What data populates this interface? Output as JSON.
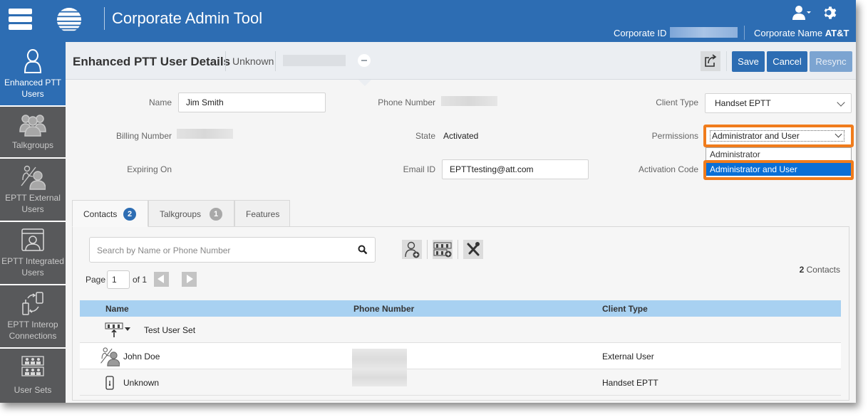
{
  "header": {
    "app_title": "Corporate Admin Tool",
    "corporate_id_label": "Corporate ID",
    "corporate_name_label": "Corporate Name",
    "corporate_name_value": "AT&T",
    "icons": [
      "menu-icon",
      "att-globe-logo",
      "user-menu-icon",
      "settings-gear-icon"
    ]
  },
  "sidebar": {
    "items": [
      {
        "label": "Enhanced PTT Users",
        "icon": "user-icon",
        "active": true
      },
      {
        "label": "Talkgroups",
        "icon": "group-icon",
        "active": false
      },
      {
        "label": "EPTT External Users",
        "icon": "external-user-icon",
        "active": false
      },
      {
        "label": "EPTT Integrated Users",
        "icon": "integrated-user-icon",
        "active": false
      },
      {
        "label": "EPTT Interop Connections",
        "icon": "interop-icon",
        "active": false
      },
      {
        "label": "User Sets",
        "icon": "user-sets-icon",
        "active": false
      }
    ]
  },
  "titlebar": {
    "title": "Enhanced PTT User Details",
    "subtitle": "Unknown",
    "buttons": {
      "save": "Save",
      "cancel": "Cancel",
      "resync": "Resync"
    }
  },
  "form": {
    "name": {
      "label": "Name",
      "value": "Jim Smith"
    },
    "phone_number": {
      "label": "Phone Number"
    },
    "client_type": {
      "label": "Client Type",
      "value": "Handset EPTT"
    },
    "billing_number": {
      "label": "Billing Number"
    },
    "state": {
      "label": "State",
      "value": "Activated"
    },
    "permissions": {
      "label": "Permissions",
      "value": "Administrator and User",
      "options": [
        "Administrator",
        "Administrator and User"
      ],
      "highlighted_option": "Administrator and User"
    },
    "expiring_on": {
      "label": "Expiring On"
    },
    "email": {
      "label": "Email ID",
      "value": "EPTTtesting@att.com"
    },
    "activation_code": {
      "label": "Activation Code"
    }
  },
  "tabs": [
    {
      "label": "Contacts",
      "badge": "2",
      "active": true
    },
    {
      "label": "Talkgroups",
      "badge": "1",
      "active": false
    },
    {
      "label": "Features",
      "badge": null,
      "active": false
    }
  ],
  "contacts": {
    "search_placeholder": "Search by Name or Phone Number",
    "page_label": "Page",
    "page_value": "1",
    "of_label": "of 1",
    "count": "2",
    "count_label": "Contacts",
    "columns": [
      "Name",
      "Phone Number",
      "Client Type"
    ],
    "rows": [
      {
        "name": "Test User Set",
        "icon": "user-set-icon",
        "client_type": ""
      },
      {
        "name": "John Doe",
        "icon": "external-user-icon",
        "client_type": "External User"
      },
      {
        "name": "Unknown",
        "icon": "handset-icon",
        "client_type": "Handset EPTT"
      }
    ]
  }
}
